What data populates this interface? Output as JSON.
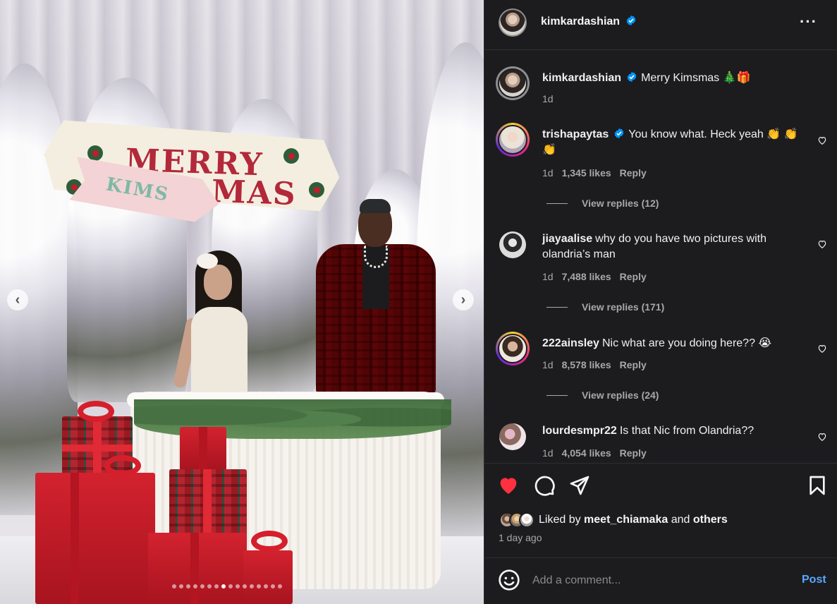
{
  "post": {
    "username": "kimkardashian",
    "caption_user": "kimkardashian",
    "caption_text": "Merry Kimsmas 🎄🎁",
    "caption_time": "1d"
  },
  "banner": {
    "line1": "MERRY",
    "line2": "MAS",
    "tag": "KIMS"
  },
  "media": {
    "dots_total": 16,
    "dot_active_index": 7
  },
  "comments": [
    {
      "user": "trishapaytas",
      "verified": true,
      "text": "You know what. Heck yeah 👏 👏 👏",
      "time": "1d",
      "likes": "1,345 likes",
      "reply": "Reply",
      "view_replies": "View replies (12)"
    },
    {
      "user": "jiayaalise",
      "verified": false,
      "text": "why do you have two pictures with olandria’s man",
      "time": "1d",
      "likes": "7,488 likes",
      "reply": "Reply",
      "view_replies": "View replies (171)"
    },
    {
      "user": "222ainsley",
      "verified": false,
      "text": "Nic what are you doing here?? 😭",
      "time": "1d",
      "likes": "8,578 likes",
      "reply": "Reply",
      "view_replies": "View replies (24)"
    },
    {
      "user": "lourdesmpr22",
      "verified": false,
      "text": "Is that Nic from Olandria??",
      "time": "1d",
      "likes": "4,054 likes",
      "reply": "Reply"
    }
  ],
  "likes": {
    "prefix": "Liked by",
    "user": "meet_chiamaka",
    "joiner": "and",
    "others": "others"
  },
  "post_time": "1 day ago",
  "composer": {
    "placeholder": "Add a comment...",
    "post_label": "Post"
  },
  "colors": {
    "like_red": "#ff3040",
    "verified_blue": "#0095f6",
    "post_blue": "#5aa7ff"
  },
  "icons": [
    "more-options-icon",
    "verified-badge-icon",
    "heart-icon",
    "comment-icon",
    "share-icon",
    "bookmark-icon",
    "emoji-icon",
    "chevron-left-icon",
    "chevron-right-icon"
  ]
}
